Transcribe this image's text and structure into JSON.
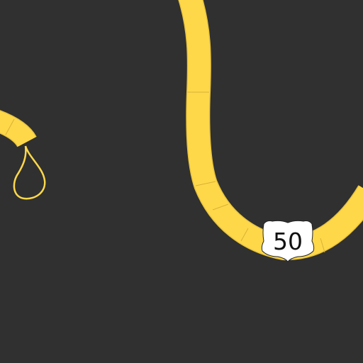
{
  "map": {
    "background_color": "#303030",
    "roads": [
      {
        "name": "",
        "route_number": "50",
        "kind": "us-highway",
        "color": "#ffd84a"
      },
      {
        "name": "",
        "route_number": "",
        "kind": "major-road",
        "color": "#ffd84a"
      },
      {
        "name": "",
        "route_number": "",
        "kind": "ramp-loop",
        "color": "#ffd84a"
      }
    ],
    "route_shields": [
      {
        "route_number": "50",
        "shape": "us-highway-shield",
        "color": "#ffffff"
      }
    ]
  }
}
